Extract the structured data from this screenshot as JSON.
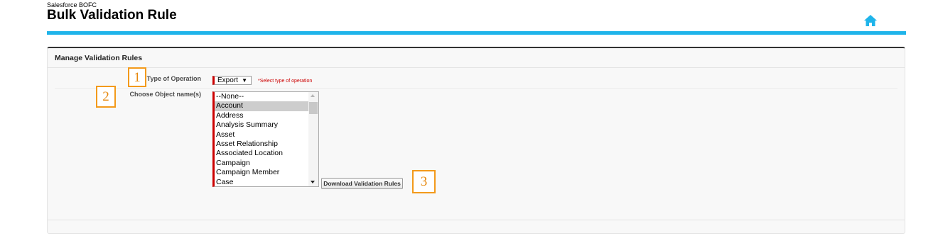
{
  "header": {
    "app_name": "Salesforce BOFC",
    "title": "Bulk Validation Rule",
    "home_icon": "home-icon",
    "accent_color": "#1fb4ea"
  },
  "section": {
    "title": "Manage Validation Rules"
  },
  "form": {
    "operation_label": "Type of Operation",
    "operation_value": "Export",
    "operation_hint": "*Select type of operation",
    "object_label": "Choose Object name(s)",
    "objects": [
      {
        "label": "--None--",
        "selected": false
      },
      {
        "label": "Account",
        "selected": true
      },
      {
        "label": "Address",
        "selected": false
      },
      {
        "label": "Analysis Summary",
        "selected": false
      },
      {
        "label": "Asset",
        "selected": false
      },
      {
        "label": "Asset Relationship",
        "selected": false
      },
      {
        "label": "Associated Location",
        "selected": false
      },
      {
        "label": "Campaign",
        "selected": false
      },
      {
        "label": "Campaign Member",
        "selected": false
      },
      {
        "label": "Case",
        "selected": false
      }
    ],
    "download_button": "Download Validation Rules"
  },
  "callouts": [
    "1",
    "2",
    "3"
  ],
  "colors": {
    "required": "#cc0000",
    "callout": "#f39a1b"
  }
}
